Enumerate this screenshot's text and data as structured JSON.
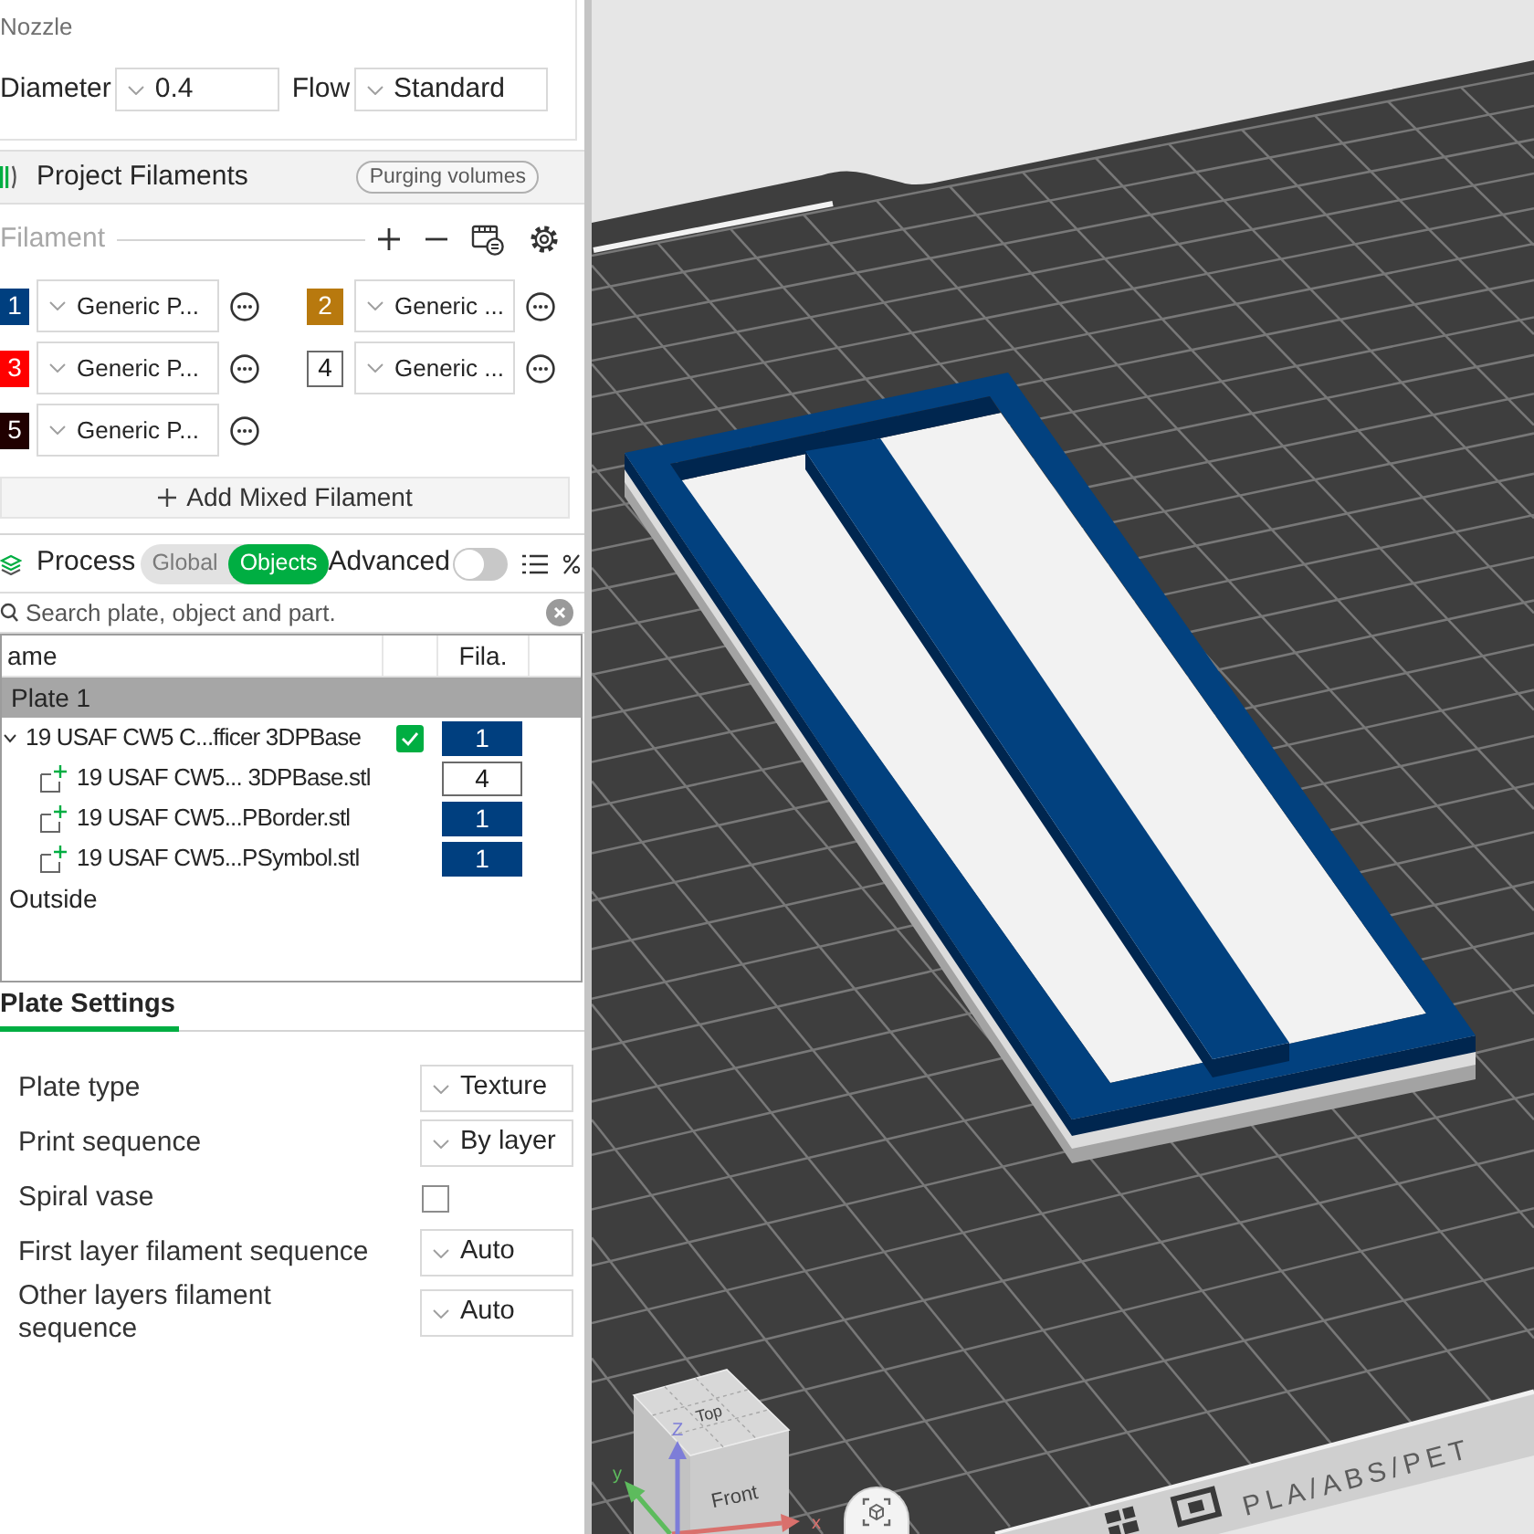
{
  "nozzle": {
    "title": "Nozzle",
    "fields": [
      {
        "label": "Diameter",
        "value": "0.4"
      },
      {
        "label": "Flow",
        "value": "Standard"
      }
    ]
  },
  "project_filaments": {
    "title": "Project Filaments",
    "purging_button": "Purging volumes",
    "toolbar_label": "Filament",
    "filaments": [
      {
        "number": "1",
        "color": "#003f7f",
        "name": "Generic P..."
      },
      {
        "number": "2",
        "color": "#b8790e",
        "name": "Generic ..."
      },
      {
        "number": "3",
        "color": "#ff0000",
        "name": "Generic P..."
      },
      {
        "number": "4",
        "color": "#ffffff",
        "name": "Generic ..."
      },
      {
        "number": "5",
        "color": "#200000",
        "name": "Generic P..."
      }
    ],
    "add_button": "Add Mixed Filament"
  },
  "process": {
    "title": "Process",
    "scope_tabs": [
      {
        "label": "Global",
        "selected": false
      },
      {
        "label": "Objects",
        "selected": true
      }
    ],
    "advanced": {
      "label": "Advanced",
      "on": false
    },
    "search": {
      "placeholder": "Search plate, object and part."
    }
  },
  "object_list": {
    "columns": [
      {
        "label": "ame"
      },
      {
        "label": "Fila."
      }
    ],
    "rows": [
      {
        "kind": "plate",
        "name": "Plate 1",
        "selected": true,
        "children": [
          {
            "kind": "object",
            "name": "19 USAF CW5 C...fficer 3DPBase",
            "selected": false,
            "expanded": true,
            "printable": true,
            "filament": {
              "number": "1",
              "color": "#003f7f"
            },
            "children": [
              {
                "kind": "part",
                "name": "19 USAF CW5... 3DPBase.stl",
                "selected": false,
                "filament": {
                  "number": "4",
                  "color": "#ffffff"
                }
              },
              {
                "kind": "part",
                "name": "19 USAF CW5...PBorder.stl",
                "selected": false,
                "filament": {
                  "number": "1",
                  "color": "#003f7f"
                }
              },
              {
                "kind": "part",
                "name": "19 USAF CW5...PSymbol.stl",
                "selected": false,
                "filament": {
                  "number": "1",
                  "color": "#003f7f"
                }
              }
            ]
          }
        ]
      },
      {
        "kind": "outside",
        "name": "Outside",
        "selected": false
      }
    ]
  },
  "plate_settings": {
    "tab": "Plate Settings",
    "rows": [
      {
        "kind": "select",
        "label": "Plate type",
        "value": "Texture"
      },
      {
        "kind": "select",
        "label": "Print sequence",
        "value": "By layer"
      },
      {
        "kind": "checkbox",
        "label": "Spiral vase",
        "checked": false
      },
      {
        "kind": "select",
        "label": "First layer filament sequence",
        "value": "Auto"
      },
      {
        "kind": "select",
        "label": "Other layers filament sequence",
        "value": "Auto"
      }
    ]
  },
  "viewport": {
    "view_cube": {
      "top": "Top",
      "front": "Front"
    },
    "axes": [
      {
        "label": "x"
      },
      {
        "label": "y"
      },
      {
        "label": "Z"
      }
    ],
    "bed_label": "PLA/ABS/PET"
  }
}
